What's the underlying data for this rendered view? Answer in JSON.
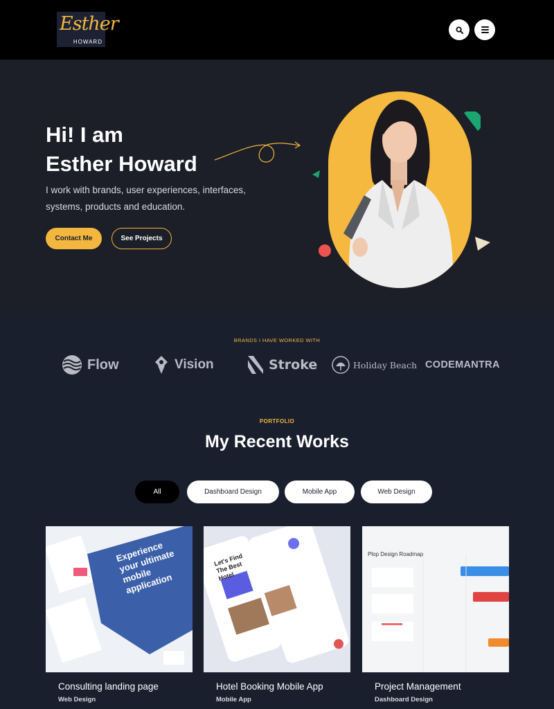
{
  "header": {
    "logo_script": "Esther",
    "logo_sub": "HOWARD",
    "search_icon": "search-icon",
    "menu_icon": "menu-icon"
  },
  "hero": {
    "title_line1": "Hi! I am",
    "title_line2": "Esther Howard",
    "description": "I work with brands, user experiences, interfaces, systems, products and education.",
    "contact_label": "Contact Me",
    "projects_label": "See Projects"
  },
  "brands": {
    "label": "BRANDS I HAVE WORKED WITH",
    "items": [
      {
        "name": "Flow",
        "icon": "waves-icon"
      },
      {
        "name": "Vision",
        "icon": "vision-icon"
      },
      {
        "name": "Stroke",
        "icon": "stroke-icon"
      },
      {
        "name": "Holiday Beach",
        "icon": "umbrella-icon"
      },
      {
        "name": "CODEMANTRA",
        "icon": ""
      }
    ]
  },
  "portfolio": {
    "kicker": "PORTFOLIO",
    "title": "My Recent Works",
    "filters": [
      "All",
      "Dashboard Design",
      "Mobile App",
      "Web Design"
    ],
    "active_filter": "All",
    "cards": [
      {
        "title": "Consulting landing page",
        "category": "Web Design",
        "preview_text": "Experience your ultimate mobile application"
      },
      {
        "title": "Hotel Booking Mobile App",
        "category": "Mobile App",
        "preview_text": "Let's Find The Best Hotel"
      },
      {
        "title": "Project Management",
        "category": "Dashboard Design",
        "preview_text": "Plop Design Roadmap"
      }
    ]
  },
  "colors": {
    "accent": "#f3b63f",
    "background": "#1a1f2e",
    "hero_background": "#1c1e28",
    "header_background": "#000000"
  }
}
